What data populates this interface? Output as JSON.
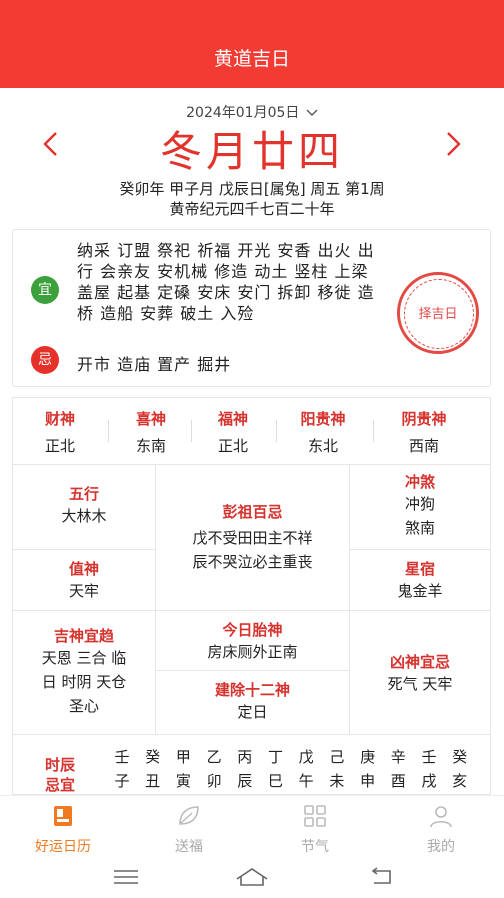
{
  "header": {
    "title": "黄道吉日"
  },
  "date": {
    "selected": "2024年01月05日",
    "lunar": "冬月廿四",
    "ganzhi": "癸卯年 甲子月 戊辰日[属兔] 周五 第1周",
    "era": "黄帝纪元四千七百二十年"
  },
  "yiji": {
    "yi_label": "宜",
    "yi_text": "纳采 订盟 祭祀 祈福 开光 安香 出火 出行 会亲友 安机械 修造 动土 竖柱 上梁 盖屋 起基 定磉 安床 安门 拆卸 移徙 造桥 造船 安葬 破土 入殓",
    "ji_label": "忌",
    "ji_text": "开市 造庙 置产 掘井",
    "stamp_label": "择吉日"
  },
  "gods": [
    {
      "name": "财神",
      "value": "正北"
    },
    {
      "name": "喜神",
      "value": "东南"
    },
    {
      "name": "福神",
      "value": "正北"
    },
    {
      "name": "阳贵神",
      "value": "东北"
    },
    {
      "name": "阴贵神",
      "value": "西南"
    }
  ],
  "grid": {
    "wuxing": {
      "name": "五行",
      "value": "大林木"
    },
    "pengzu": {
      "name": "彭祖百忌",
      "line1": "戊不受田田主不祥",
      "line2": "辰不哭泣必主重丧"
    },
    "chongsha": {
      "name": "冲煞",
      "line1": "冲狗",
      "line2": "煞南"
    },
    "zhishen": {
      "name": "值神",
      "value": "天牢"
    },
    "xingxiu": {
      "name": "星宿",
      "value": "鬼金羊"
    },
    "jishen": {
      "name": "吉神宜趋",
      "line1": "天恩 三合 临",
      "line2": "日 时阴 天仓",
      "line3": "圣心"
    },
    "taishen": {
      "name": "今日胎神",
      "value": "房床厕外正南"
    },
    "jianchu": {
      "name": "建除十二神",
      "value": "定日"
    },
    "xiongshen": {
      "name": "凶神宜忌",
      "value": "死气 天牢"
    }
  },
  "shichen": {
    "label_line1": "时辰",
    "label_line2": "忌宜",
    "columns": [
      {
        "gan": "壬",
        "zhi": "子"
      },
      {
        "gan": "癸",
        "zhi": "丑"
      },
      {
        "gan": "甲",
        "zhi": "寅"
      },
      {
        "gan": "乙",
        "zhi": "卯"
      },
      {
        "gan": "丙",
        "zhi": "辰"
      },
      {
        "gan": "丁",
        "zhi": "巳"
      },
      {
        "gan": "戊",
        "zhi": "午"
      },
      {
        "gan": "己",
        "zhi": "未"
      },
      {
        "gan": "庚",
        "zhi": "申"
      },
      {
        "gan": "辛",
        "zhi": "酉"
      },
      {
        "gan": "壬",
        "zhi": "戌"
      },
      {
        "gan": "癸",
        "zhi": "亥"
      }
    ]
  },
  "tabs": [
    {
      "label": "好运日历",
      "icon": "calendar-icon"
    },
    {
      "label": "送福",
      "icon": "leaf-icon"
    },
    {
      "label": "节气",
      "icon": "grid-icon"
    },
    {
      "label": "我的",
      "icon": "user-icon"
    }
  ],
  "colors": {
    "header_red": "#f23b33",
    "accent_red": "#e2332c",
    "yi_green": "#3ca03c",
    "active_orange": "#f07a22"
  }
}
